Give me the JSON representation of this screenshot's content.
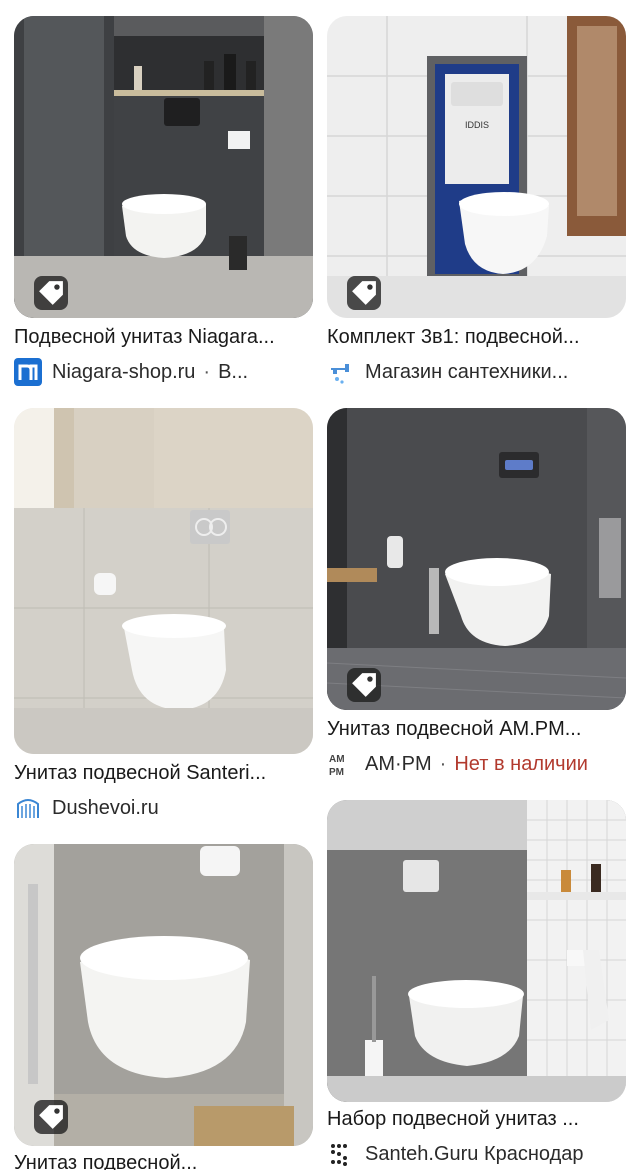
{
  "results": [
    {
      "title": "Подвесной унитаз Niagara...",
      "source": "Niagara-shop.ru",
      "extra": "В...",
      "logo": "niagara-logo"
    },
    {
      "title": "Комплект 3в1: подвесной...",
      "source": "Магазин сантехники...",
      "logo": "faucet-logo"
    },
    {
      "title": "Унитаз подвесной Santeri...",
      "source": "Dushevoi.ru",
      "logo": "dushevoi-logo"
    },
    {
      "title": "Унитаз подвесной AM.PM...",
      "source": "AM·PM",
      "status": "Нет в наличии",
      "logo": "ampm-logo"
    },
    {
      "title": "Унитаз подвесной...",
      "logo": "none"
    },
    {
      "title": "Набор подвесной унитаз ...",
      "source": "Santeh.Guru Краснодар",
      "logo": "santeh-logo"
    }
  ],
  "thumb_texts": {
    "frame_brand": "IDDIS"
  },
  "colors": {
    "status_out_of_stock": "#b23a2e",
    "tag_bg": "#1e1e1e",
    "niagara_blue": "#1b6fd1"
  }
}
